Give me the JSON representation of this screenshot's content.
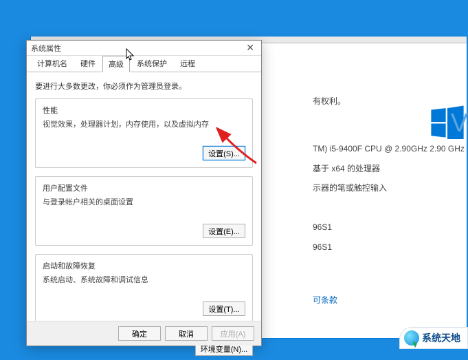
{
  "bg": {
    "rights": "有权利。",
    "cpu": "TM) i5-9400F CPU @ 2.90GHz   2.90 GHz",
    "arch": "基于 x64 的处理器",
    "pen": "示器的笔或触控输入",
    "code1": "96S1",
    "code2": "96S1",
    "link": "可条款"
  },
  "dialog": {
    "title": "系统属性",
    "tabs": [
      "计算机名",
      "硬件",
      "高级",
      "系统保护",
      "远程"
    ],
    "active_tab": 2,
    "intro": "要进行大多数更改，你必须作为管理员登录。",
    "perf": {
      "title": "性能",
      "sub": "视觉效果，处理器计划，内存使用，以及虚拟内存",
      "btn": "设置(S)..."
    },
    "profile": {
      "title": "用户配置文件",
      "sub": "与登录帐户相关的桌面设置",
      "btn": "设置(E)..."
    },
    "startup": {
      "title": "启动和故障恢复",
      "sub": "系统启动、系统故障和调试信息",
      "btn": "设置(T)..."
    },
    "env_btn": "环境变量(N)...",
    "footer": {
      "ok": "确定",
      "cancel": "取消",
      "apply": "应用(A)"
    }
  },
  "win_v": "V",
  "watermark": "系统天地"
}
